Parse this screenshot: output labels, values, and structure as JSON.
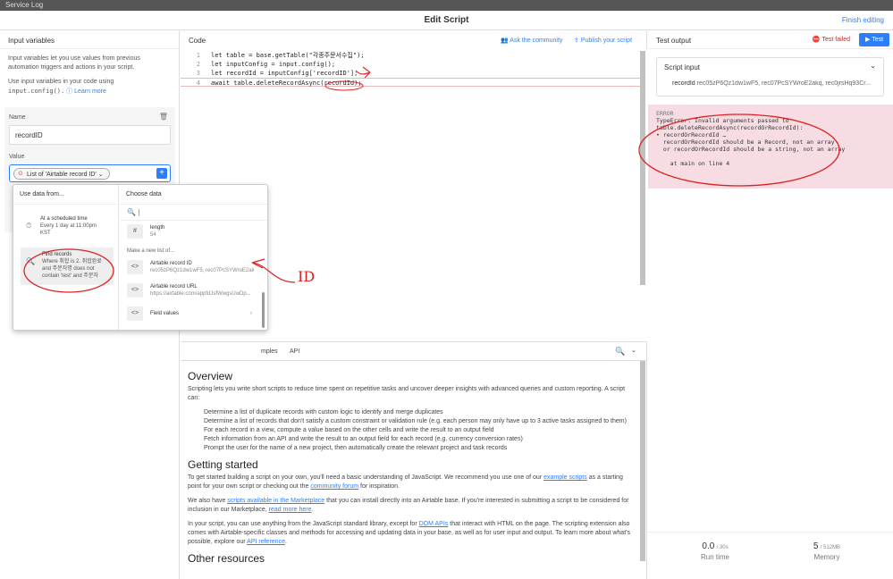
{
  "window": {
    "top_strip_text": "Service Log",
    "title": "Edit Script",
    "finish_label": "Finish editing"
  },
  "left": {
    "header": "Input variables",
    "desc1": "Input variables let you use values from previous automation triggers and actions in your script.",
    "desc2a": "Use input variables in your code using",
    "desc2_code": "input.config().",
    "learn_more": "Learn more",
    "name_label": "Name",
    "name_value": "recordID",
    "value_label": "Value",
    "value_chip": "List of 'Airtable record ID'"
  },
  "popup": {
    "left_header": "Use data from...",
    "right_header": "Choose data",
    "sched_title": "At a scheduled time",
    "sched_sub1": "Every 1 day at 11:00pm",
    "sched_sub2": "KST",
    "find_title": "Find records",
    "find_sub1": "Where 취합 is 2. 취합완료",
    "find_sub2": "and 주문자명 does not",
    "find_sub3": "contain 'test' and 주문자",
    "length_label": "length",
    "length_value": "54",
    "make_new": "Make a new list of...",
    "opt1_title": "Airtable record ID",
    "opt1_sub": "rec05zP6Qz1dw1wF5, rec07PcSYWroE2akq",
    "opt2_title": "Airtable record URL",
    "opt2_sub": "https://airtable.com/appfdJsfWwgsUwDp...",
    "opt3_title": "Field values",
    "annotation": "ID"
  },
  "code": {
    "header": "Code",
    "ask": "Ask the community",
    "publish": "Publish your script",
    "lines": [
      {
        "n": "1",
        "t": "let table = base.getTable(\"각종주문서수집\");"
      },
      {
        "n": "2",
        "t": "let inputConfig = input.config();"
      },
      {
        "n": "3",
        "t": "let recordId = inputConfig['recordID'];"
      },
      {
        "n": "4",
        "t": "await table.deleteRecordAsync(recordId);"
      }
    ]
  },
  "docs": {
    "tab_examples": "mples",
    "tab_api": "API",
    "overview_h": "Overview",
    "overview_p": "Scripting lets you write short scripts to reduce time spent on repetitive tasks and uncover deeper insights with advanced queries and custom reporting. A script can:",
    "bullets": [
      "Determine a list of duplicate records with custom logic to identify and merge duplicates",
      "Determine a list of records that don't satisfy a custom constraint or validation rule (e.g. each person may only have up to 3 active tasks assigned to them)",
      "For each record in a view, compute a value based on the other cells and write the result to an output field",
      "Fetch information from an API and write the result to an output field for each record (e.g. currency conversion rates)",
      "Prompt the user for the name of a new project, then automatically create the relevant project and task records"
    ],
    "gs_h": "Getting started",
    "gs_p1a": "To get started building a script on your own, you'll need a basic understanding of JavaScript. We recommend you use one of our",
    "gs_p1_link1": "example scripts",
    "gs_p1b": "as a starting point for your own script or checking out the",
    "gs_p1_link2": "community forum",
    "gs_p1c": "for inspiration.",
    "gs_p2a": "We also have",
    "gs_p2_link1": "scripts available in the Marketplace",
    "gs_p2b": "that you can install directly into an Airtable base. If you're interested in submitting a script to be considered for inclusion in our Marketplace,",
    "gs_p2_link2": "read more here",
    "gs_p2c": ".",
    "gs_p3a": "In your script, you can use anything from the JavaScript standard library, except for",
    "gs_p3_link1": "DOM APIs",
    "gs_p3b": "that interact with HTML on the page. The scripting extension also comes with Airtable-specific classes and methods for accessing and updating data in your base, as well as for user input and output. To learn more about what's possible, explore our",
    "gs_p3_link2": "API reference",
    "gs_p3c": ".",
    "other_h": "Other resources"
  },
  "right": {
    "header": "Test output",
    "test_failed": "Test failed",
    "test_btn": "Test",
    "script_input": "Script input",
    "record_key": "recordId",
    "record_val": "rec05zP6Qz1dw1wF5, rec07PcSYWroE2akq, rec0jrsHq93Cr...",
    "error_label": "ERROR",
    "error_text": "TypeError: Invalid arguments passed to\ntable.deleteRecordAsync(recordOrRecordId):\n• recordOrRecordId …\n  recordOrRecordId should be a Record, not an array\n  or recordOrRecordId should be a string, not an array\n\n    at main on line 4",
    "run_time_val": "0.0",
    "run_time_max": "/ 30s",
    "run_time_label": "Run time",
    "memory_val": "5",
    "memory_max": "/ 512MB",
    "memory_label": "Memory"
  }
}
